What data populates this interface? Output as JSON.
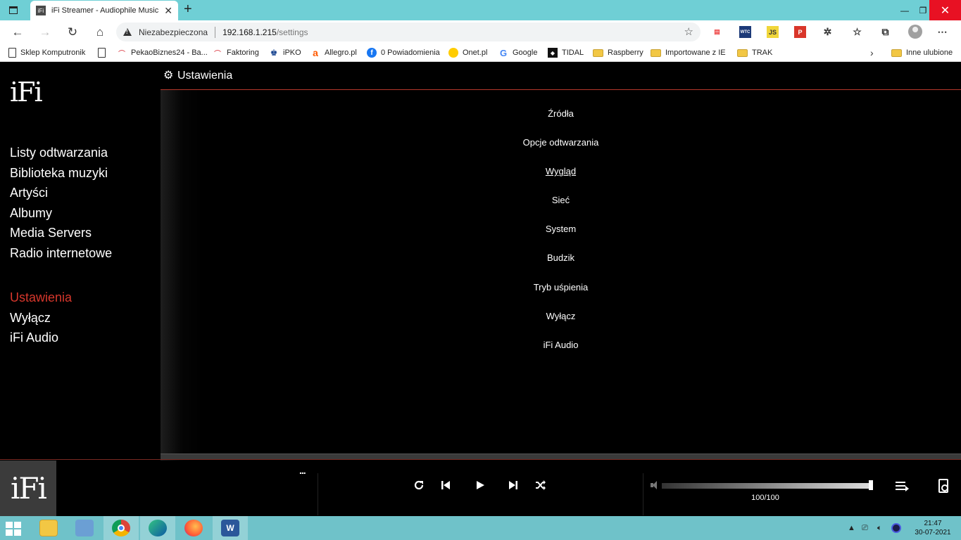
{
  "browser": {
    "tab_title": "iFi Streamer - Audiophile Music P",
    "tab_favicon": "iFi",
    "insecure_label": "Niezabezpieczona",
    "url_host": "192.168.1.215",
    "url_path": "/settings",
    "bookmarks": [
      {
        "label": "Sklep Komputronik",
        "icon": "page-icon"
      },
      {
        "label": "PekaoBiznes24 - Ba...",
        "icon": "pekao-icon"
      },
      {
        "label": "Faktoring",
        "icon": "pekao-icon"
      },
      {
        "label": "iPKO",
        "icon": "ipko-icon"
      },
      {
        "label": "Allegro.pl",
        "icon": "allegro-icon"
      },
      {
        "label": "0 Powiadomienia",
        "icon": "facebook-icon"
      },
      {
        "label": "Onet.pl",
        "icon": "onet-icon"
      },
      {
        "label": "Google",
        "icon": "google-icon"
      },
      {
        "label": "TIDAL",
        "icon": "tidal-icon"
      },
      {
        "label": "Raspberry",
        "icon": "folder-icon"
      },
      {
        "label": "Importowane z IE",
        "icon": "folder-icon"
      },
      {
        "label": "TRAK",
        "icon": "folder-icon"
      }
    ],
    "other_favorites": "Inne ulubione",
    "extensions": [
      "pdf-ext",
      "wtc-ext",
      "js-ext",
      "p-ext"
    ]
  },
  "sidebar": {
    "logo": "iFi",
    "primary": [
      {
        "label": "Listy odtwarzania"
      },
      {
        "label": "Biblioteka muzyki"
      },
      {
        "label": "Artyści"
      },
      {
        "label": "Albumy"
      },
      {
        "label": "Media Servers"
      },
      {
        "label": "Radio internetowe"
      }
    ],
    "secondary": [
      {
        "label": "Ustawienia",
        "active": true
      },
      {
        "label": "Wyłącz"
      },
      {
        "label": "iFi Audio"
      }
    ]
  },
  "main": {
    "title": "Ustawienia",
    "items": [
      {
        "label": "Źródła"
      },
      {
        "label": "Opcje odtwarzania"
      },
      {
        "label": "Wygląd",
        "underlined": true
      },
      {
        "label": "Sieć"
      },
      {
        "label": "System"
      },
      {
        "label": "Budzik"
      },
      {
        "label": "Tryb uśpienia"
      },
      {
        "label": "Wyłącz"
      },
      {
        "label": "iFi Audio"
      }
    ]
  },
  "player": {
    "logo": "iFi",
    "more": "...",
    "volume_text": "100/100",
    "volume_level": 1.0
  },
  "taskbar": {
    "time": "21:47",
    "date": "30-07-2021"
  },
  "colors": {
    "accent_red": "#d7372c",
    "taskbar": "#6fc2c9",
    "tabbar": "#6fcfd5"
  }
}
